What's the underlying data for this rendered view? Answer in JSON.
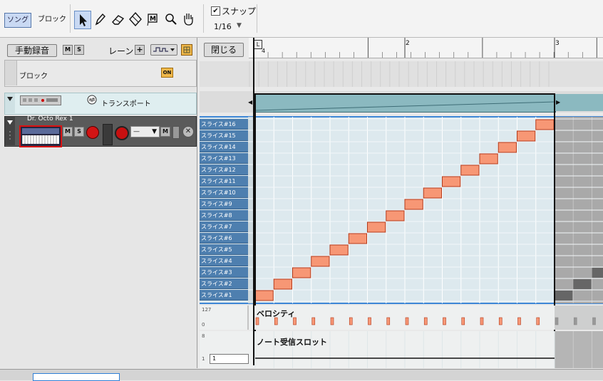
{
  "toolbar": {
    "mode_song": "ソング",
    "mode_block": "ブロック",
    "snap_label": "スナップ",
    "snap_checked": "✔",
    "snap_value": "1/16"
  },
  "icons": [
    "pointer-icon",
    "pencil-icon",
    "eraser-icon",
    "razor-icon",
    "mute-tool-icon",
    "magnify-icon",
    "hand-icon"
  ],
  "left": {
    "manual_rec": "手動録音",
    "mute": "M",
    "solo": "S",
    "lane_label": "レーン",
    "plus": "+",
    "block_track": "ブロック",
    "on_badge": "ON",
    "transport_track": "トランスポート",
    "instrument_name": "Dr. Octo Rex 1",
    "dash": "—"
  },
  "editor": {
    "close_button": "閉じる",
    "ruler": [
      "4",
      "2",
      "3"
    ],
    "loop_marker": "L",
    "slices": [
      "スライス#16",
      "スライス#15",
      "スライス#14",
      "スライス#13",
      "スライス#12",
      "スライス#11",
      "スライス#10",
      "スライス#9",
      "スライス#8",
      "スライス#7",
      "スライス#6",
      "スライス#5",
      "スライス#4",
      "スライス#3",
      "スライス#2",
      "スライス#1"
    ],
    "velocity_label": "ベロシティ",
    "velocity_max": "127",
    "velocity_min": "0",
    "slot_label": "ノート受信スロット",
    "slot_max": "8",
    "slot_min": "1",
    "slot_value": "1"
  },
  "colors": {
    "note": "#f79775",
    "note_border": "#b33a1b",
    "slice_key": "#4e7faf",
    "grid_bg": "#dde9ee",
    "outside_bg": "#a9a9a9",
    "outside_note": "#666666",
    "accent_blue": "#3f87d6"
  }
}
